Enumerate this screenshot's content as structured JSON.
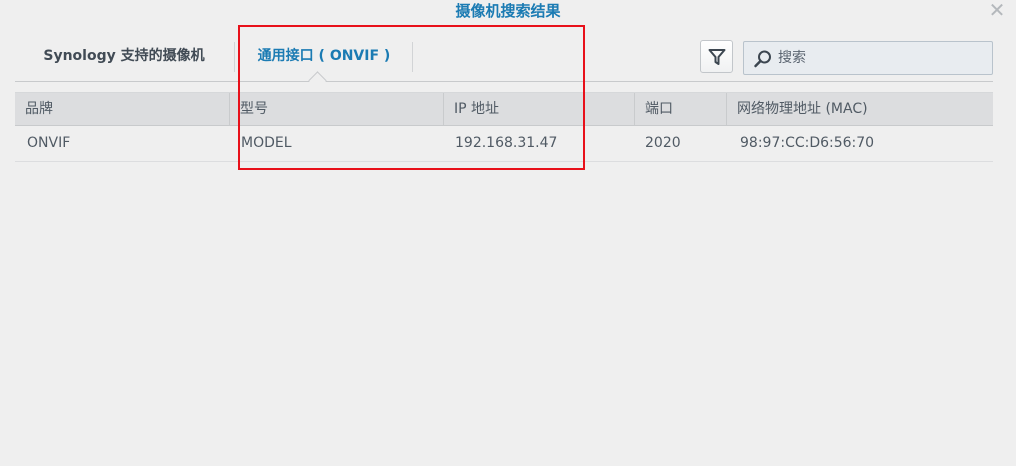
{
  "dialog": {
    "title": "摄像机搜索结果",
    "close_glyph": "✕"
  },
  "tabs": [
    {
      "label": "Synology 支持的摄像机",
      "active": false
    },
    {
      "label": "通用接口 ( ONVIF )",
      "active": true
    }
  ],
  "toolbar": {
    "filter_icon": "filter-icon",
    "search_placeholder": "搜索",
    "search_value": ""
  },
  "table": {
    "columns": [
      "品牌",
      "型号",
      "IP 地址",
      "端口",
      "网络物理地址 (MAC)"
    ],
    "rows": [
      [
        "ONVIF",
        "MODEL",
        "192.168.31.47",
        "2020",
        "98:97:CC:D6:56:70"
      ]
    ]
  },
  "colors": {
    "accent": "#1b7bb3",
    "highlight": "#e8101a",
    "background": "#efefef"
  }
}
